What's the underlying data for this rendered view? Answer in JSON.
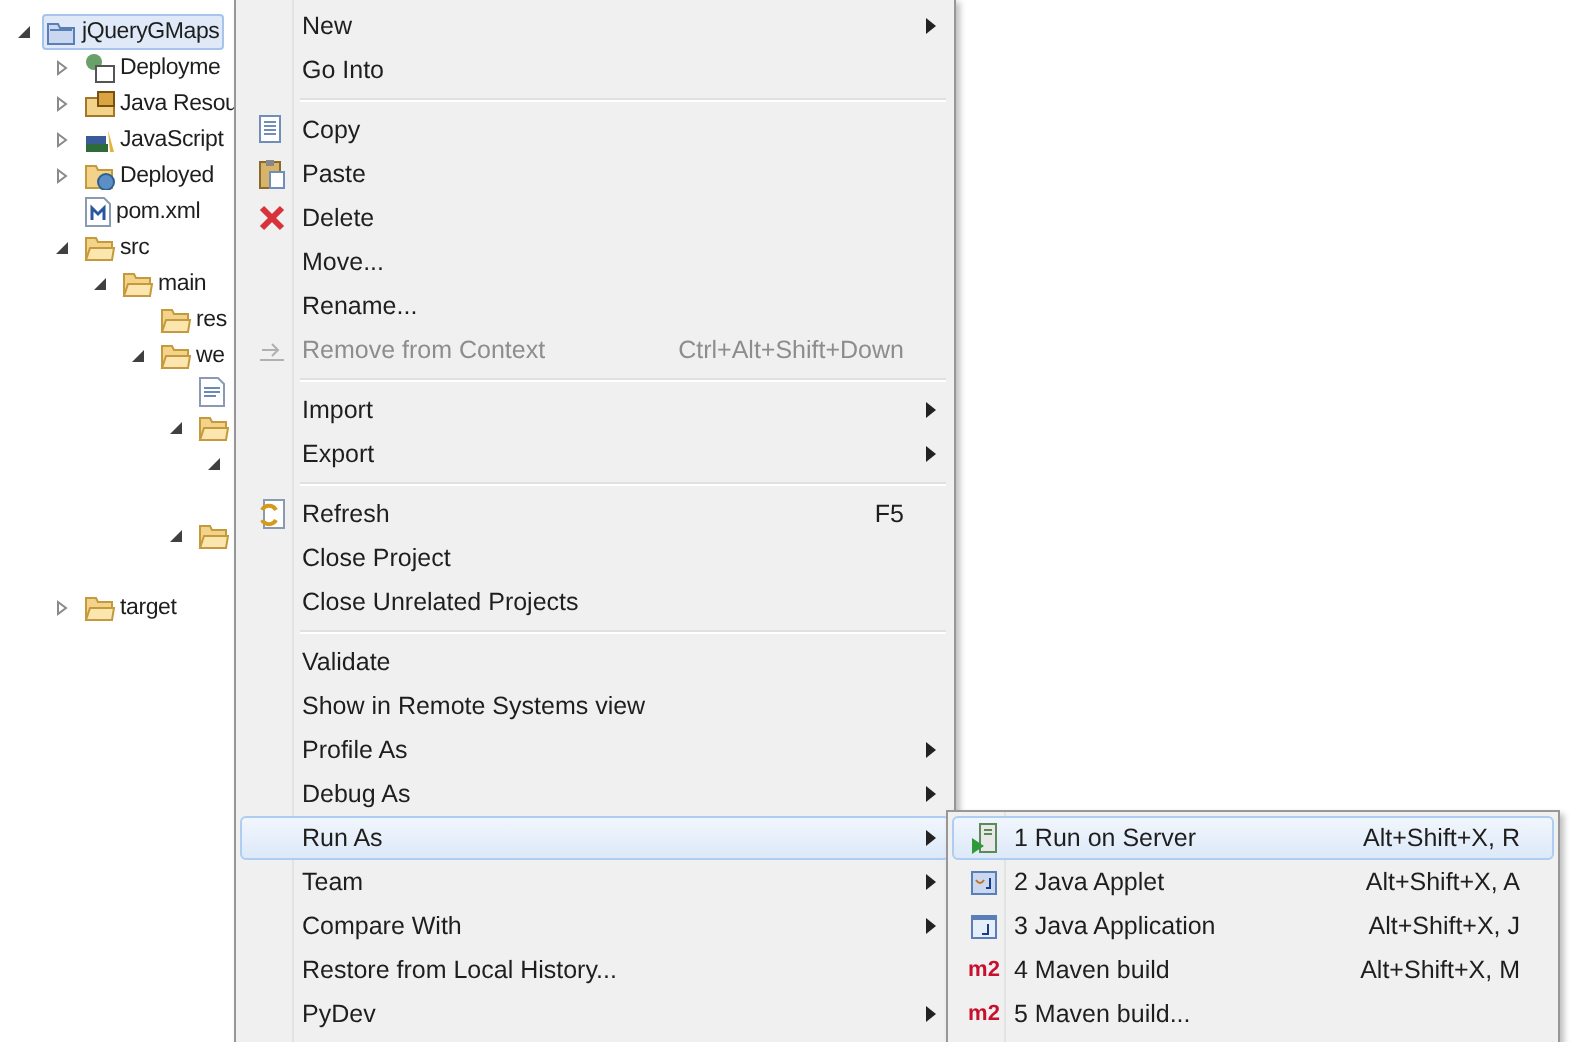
{
  "tree": [
    {
      "label": "jQueryGMaps",
      "kind": "project",
      "selected": true,
      "expanded": true,
      "children": [
        {
          "label": "Deployme",
          "kind": "deployment",
          "selected": false,
          "expanded": false
        },
        {
          "label": "Java Resou",
          "kind": "java-resources",
          "selected": false,
          "expanded": false
        },
        {
          "label": "JavaScript",
          "kind": "javascript",
          "selected": false,
          "expanded": false
        },
        {
          "label": "Deployed",
          "kind": "deployed",
          "selected": false,
          "expanded": false
        },
        {
          "label": "pom.xml",
          "kind": "maven-file",
          "selected": false
        },
        {
          "label": "src",
          "kind": "folder",
          "selected": false,
          "expanded": true,
          "children": [
            {
              "label": "main",
              "kind": "folder",
              "selected": false,
              "expanded": true,
              "children": [
                {
                  "label": "res",
                  "kind": "folder",
                  "selected": false
                },
                {
                  "label": "we",
                  "kind": "folder",
                  "selected": false,
                  "expanded": true,
                  "children": [
                    {
                      "kind": "file",
                      "selected": false
                    },
                    {
                      "kind": "folder",
                      "selected": false,
                      "expanded": true,
                      "children": [
                        {
                          "expanded": true
                        }
                      ]
                    },
                    {
                      "kind": "folder",
                      "selected": false,
                      "expanded": true
                    }
                  ]
                }
              ]
            }
          ]
        },
        {
          "label": "target",
          "kind": "folder",
          "selected": false,
          "expanded": false
        }
      ]
    }
  ],
  "context_menu": [
    {
      "kind": "item",
      "label": "New",
      "has_submenu": true,
      "disabled": false,
      "selected": false
    },
    {
      "kind": "item",
      "label": "Go Into",
      "has_submenu": false,
      "disabled": false,
      "selected": false
    },
    {
      "kind": "separator"
    },
    {
      "kind": "copy",
      "label": "Copy",
      "has_submenu": false,
      "disabled": false,
      "selected": false
    },
    {
      "kind": "paste",
      "label": "Paste",
      "has_submenu": false,
      "disabled": false,
      "selected": false
    },
    {
      "kind": "delete",
      "label": "Delete",
      "has_submenu": false,
      "disabled": false,
      "selected": false
    },
    {
      "kind": "item",
      "label": "Move...",
      "has_submenu": false,
      "disabled": false,
      "selected": false
    },
    {
      "kind": "item",
      "label": "Rename...",
      "has_submenu": false,
      "disabled": false,
      "selected": false
    },
    {
      "kind": "remove",
      "label": "Remove from Context",
      "shortcut": "Ctrl+Alt+Shift+Down",
      "has_submenu": false,
      "disabled": true,
      "selected": false
    },
    {
      "kind": "separator"
    },
    {
      "kind": "item",
      "label": "Import",
      "has_submenu": true,
      "disabled": false,
      "selected": false
    },
    {
      "kind": "item",
      "label": "Export",
      "has_submenu": true,
      "disabled": false,
      "selected": false
    },
    {
      "kind": "separator"
    },
    {
      "kind": "refresh",
      "label": "Refresh",
      "shortcut": "F5",
      "has_submenu": false,
      "disabled": false,
      "selected": false
    },
    {
      "kind": "item",
      "label": "Close Project",
      "has_submenu": false,
      "disabled": false,
      "selected": false
    },
    {
      "kind": "item",
      "label": "Close Unrelated Projects",
      "has_submenu": false,
      "disabled": false,
      "selected": false
    },
    {
      "kind": "separator"
    },
    {
      "kind": "item",
      "label": "Validate",
      "has_submenu": false,
      "disabled": false,
      "selected": false
    },
    {
      "kind": "item",
      "label": "Show in Remote Systems view",
      "has_submenu": false,
      "disabled": false,
      "selected": false
    },
    {
      "kind": "item",
      "label": "Profile As",
      "has_submenu": true,
      "disabled": false,
      "selected": false
    },
    {
      "kind": "item",
      "label": "Debug As",
      "has_submenu": true,
      "disabled": false,
      "selected": false
    },
    {
      "kind": "item",
      "label": "Run As",
      "has_submenu": true,
      "disabled": false,
      "selected": true
    },
    {
      "kind": "item",
      "label": "Team",
      "has_submenu": true,
      "disabled": false,
      "selected": false
    },
    {
      "kind": "item",
      "label": "Compare With",
      "has_submenu": true,
      "disabled": false,
      "selected": false
    },
    {
      "kind": "item",
      "label": "Restore from Local History...",
      "has_submenu": false,
      "disabled": false,
      "selected": false
    },
    {
      "kind": "item",
      "label": "PyDev",
      "has_submenu": true,
      "disabled": false,
      "selected": false
    }
  ],
  "run_as_submenu": [
    {
      "kind": "server",
      "label": "1 Run on Server",
      "shortcut": "Alt+Shift+X, R",
      "selected": true
    },
    {
      "kind": "applet",
      "label": "2 Java Applet",
      "shortcut": "Alt+Shift+X, A",
      "selected": false
    },
    {
      "kind": "application",
      "label": "3 Java Application",
      "shortcut": "Alt+Shift+X, J",
      "selected": false
    },
    {
      "kind": "maven",
      "icon_text": "m2",
      "label": "4 Maven build",
      "shortcut": "Alt+Shift+X, M",
      "selected": false
    },
    {
      "kind": "maven",
      "icon_text": "m2",
      "label": "5 Maven build...",
      "selected": false
    }
  ]
}
